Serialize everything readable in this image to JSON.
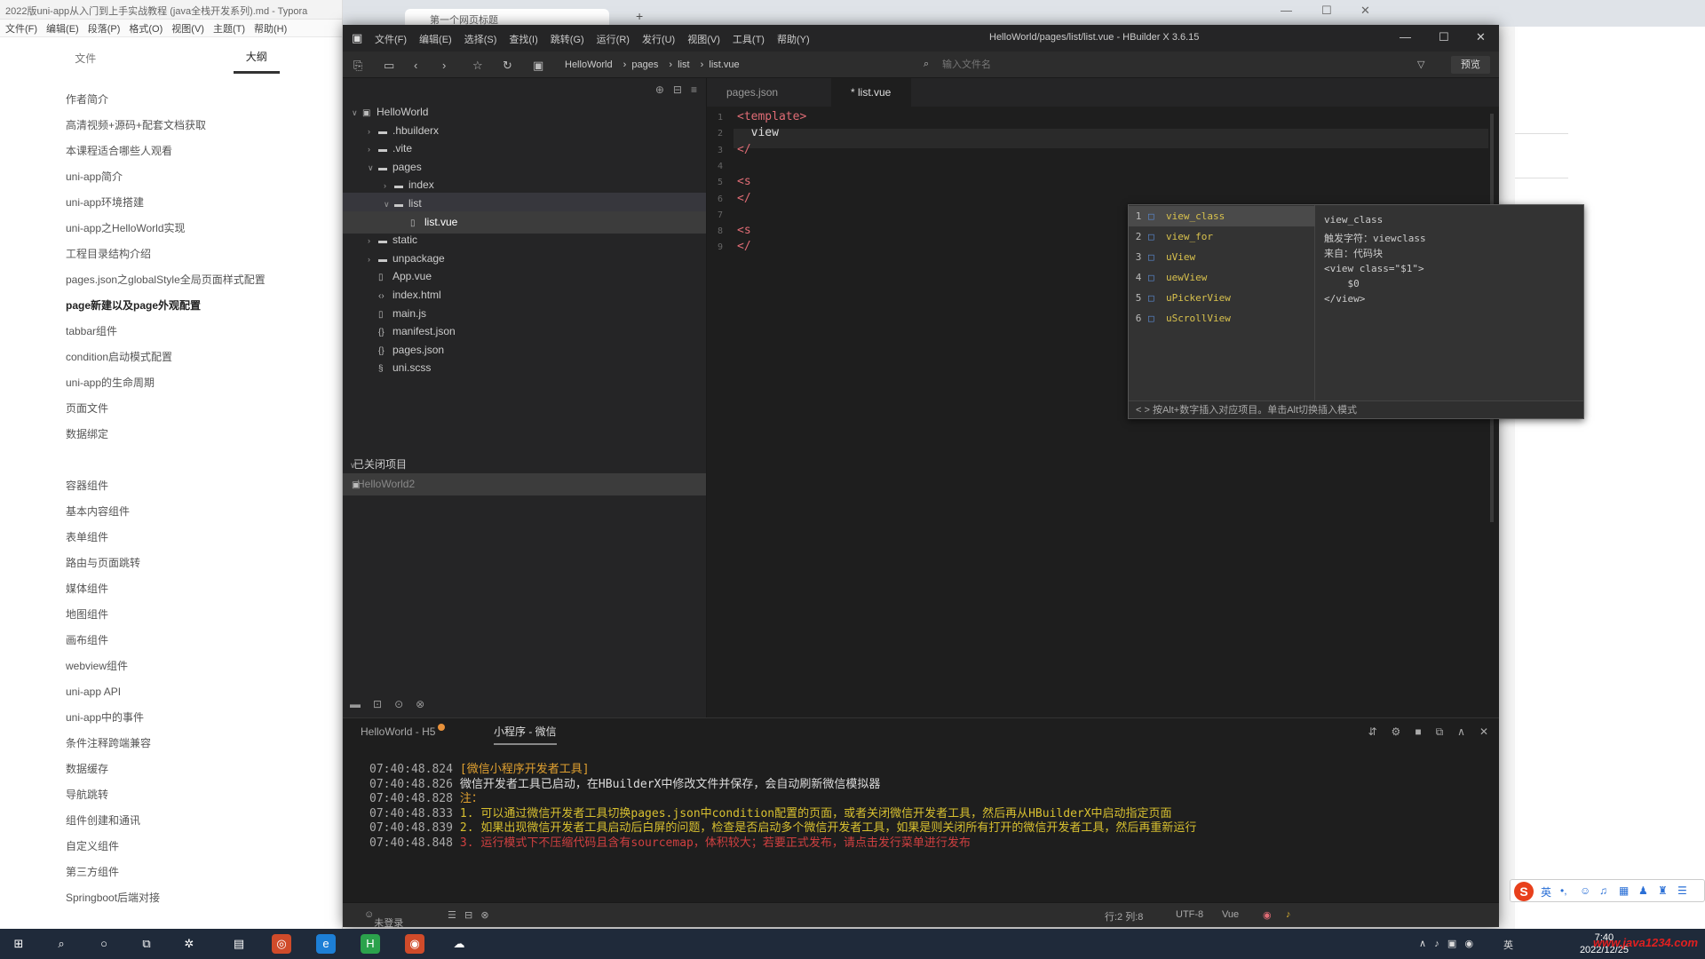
{
  "typora": {
    "title": "2022版uni-app从入门到上手实战教程 (java全栈开发系列).md - Typora",
    "menus": [
      "文件(F)",
      "编辑(E)",
      "段落(P)",
      "格式(O)",
      "视图(V)",
      "主题(T)",
      "帮助(H)"
    ],
    "tabs": [
      "文件",
      "大纲"
    ],
    "outline_group1": [
      "作者简介",
      "高清视频+源码+配套文档获取",
      "本课程适合哪些人观看",
      "uni-app简介",
      "uni-app环境搭建",
      "uni-app之HelloWorld实现",
      "工程目录结构介绍",
      "pages.json之globalStyle全局页面样式配置",
      "page新建以及page外观配置",
      "tabbar组件",
      "condition启动模式配置",
      "uni-app的生命周期",
      "页面文件",
      "数据绑定"
    ],
    "outline_group2": [
      "容器组件",
      "基本内容组件",
      "表单组件",
      "路由与页面跳转",
      "媒体组件",
      "地图组件",
      "画布组件",
      "webview组件",
      "uni-app API",
      "uni-app中的事件",
      "条件注释跨端兼容",
      "数据缓存",
      "导航跳转",
      "组件创建和通讯",
      "自定义组件",
      "第三方组件",
      "Springboot后端对接"
    ]
  },
  "browser": {
    "tab_title": "第一个网页标题"
  },
  "hbuilder": {
    "menus": [
      "文件(F)",
      "编辑(E)",
      "选择(S)",
      "查找(I)",
      "跳转(G)",
      "运行(R)",
      "发行(U)",
      "视图(V)",
      "工具(T)",
      "帮助(Y)"
    ],
    "window_title": "HelloWorld/pages/list/list.vue - HBuilder X 3.6.15",
    "breadcrumb": [
      "HelloWorld",
      "pages",
      "list",
      "list.vue"
    ],
    "search_placeholder": "输入文件名",
    "preview_label": "预览",
    "tree": [
      {
        "label": "HelloWorld",
        "depth": 0,
        "arrow": "∨",
        "icon": "project"
      },
      {
        "label": ".hbuilderx",
        "depth": 1,
        "arrow": "›",
        "icon": "folder"
      },
      {
        "label": ".vite",
        "depth": 1,
        "arrow": "›",
        "icon": "folder"
      },
      {
        "label": "pages",
        "depth": 1,
        "arrow": "∨",
        "icon": "folder"
      },
      {
        "label": "index",
        "depth": 2,
        "arrow": "›",
        "icon": "folder"
      },
      {
        "label": "list",
        "depth": 2,
        "arrow": "∨",
        "icon": "folder"
      },
      {
        "label": "list.vue",
        "depth": 3,
        "arrow": "",
        "icon": "file"
      },
      {
        "label": "static",
        "depth": 1,
        "arrow": "›",
        "icon": "folder"
      },
      {
        "label": "unpackage",
        "depth": 1,
        "arrow": "›",
        "icon": "folder"
      },
      {
        "label": "App.vue",
        "depth": 1,
        "arrow": "",
        "icon": "file"
      },
      {
        "label": "index.html",
        "depth": 1,
        "arrow": "",
        "icon": "html"
      },
      {
        "label": "main.js",
        "depth": 1,
        "arrow": "",
        "icon": "file"
      },
      {
        "label": "manifest.json",
        "depth": 1,
        "arrow": "",
        "icon": "json"
      },
      {
        "label": "pages.json",
        "depth": 1,
        "arrow": "",
        "icon": "json"
      },
      {
        "label": "uni.scss",
        "depth": 1,
        "arrow": "",
        "icon": "style"
      }
    ],
    "closed_projects_label": "已关闭项目",
    "closed_project": "HelloWorld2",
    "editor_tabs": [
      "pages.json",
      "* list.vue"
    ],
    "code_lines": [
      {
        "n": "1",
        "text": "<template>",
        "color": "#e06c75"
      },
      {
        "n": "2",
        "text": "  view",
        "color": "#dddddd"
      },
      {
        "n": "3",
        "text": "</",
        "color": "#e06c75"
      },
      {
        "n": "4",
        "text": "",
        "color": "#dddddd"
      },
      {
        "n": "5",
        "text": "<s",
        "color": "#e06c75"
      },
      {
        "n": "6",
        "text": "</",
        "color": "#e06c75"
      },
      {
        "n": "7",
        "text": "",
        "color": "#dddddd"
      },
      {
        "n": "8",
        "text": "<s",
        "color": "#e06c75"
      },
      {
        "n": "9",
        "text": "</",
        "color": "#e06c75"
      }
    ],
    "autocomplete": {
      "items": [
        {
          "num": "1",
          "label": "view_class"
        },
        {
          "num": "2",
          "label": "view_for"
        },
        {
          "num": "3",
          "label": "uView"
        },
        {
          "num": "4",
          "label": "uewView"
        },
        {
          "num": "5",
          "label": "uPickerView"
        },
        {
          "num": "6",
          "label": "uScrollView"
        }
      ],
      "detail": [
        "view_class",
        "",
        "触发字符：viewclass",
        "来自：代码块",
        "",
        "<view class=\"$1\">",
        "    $0",
        "</view>"
      ],
      "footer": "< > 按Alt+数字插入对应项目。单击Alt切换插入模式"
    },
    "console": {
      "tabs": [
        "HelloWorld - H5",
        "小程序 - 微信"
      ],
      "lines": [
        {
          "ts": "07:40:48.824",
          "text": "[微信小程序开发者工具]",
          "color": "#e0a030"
        },
        {
          "ts": "07:40:48.826",
          "text": "微信开发者工具已启动，在HBuilderX中修改文件并保存，会自动刷新微信模拟器",
          "color": "#dddddd"
        },
        {
          "ts": "07:40:48.828",
          "text": "注：",
          "color": "#e0a030"
        },
        {
          "ts": "07:40:48.833",
          "text": "1. 可以通过微信开发者工具切换pages.json中condition配置的页面，或者关闭微信开发者工具，然后再从HBuilderX中启动指定页面",
          "color": "#d8c030"
        },
        {
          "ts": "07:40:48.839",
          "text": "2. 如果出现微信开发者工具启动后白屏的问题，检查是否启动多个微信开发者工具，如果是则关闭所有打开的微信开发者工具，然后再重新运行",
          "color": "#d8c030"
        },
        {
          "ts": "07:40:48.848",
          "text": "3. 运行模式下不压缩代码且含有sourcemap，体积较大；若要正式发布，请点击发行菜单进行发布",
          "color": "#d04040"
        }
      ]
    },
    "status": {
      "left": "未登录",
      "position": "行:2  列:8",
      "encoding": "UTF-8",
      "language": "Vue"
    }
  },
  "taskbar": {
    "tray_lang": "英",
    "time": "7:40",
    "date": "2022/12/25",
    "watermark": "www.java1234.com"
  },
  "colors": {
    "hb_bg": "#1e1e1e",
    "accent_tag": "#e06c75",
    "snippet": "#d8c14d"
  }
}
